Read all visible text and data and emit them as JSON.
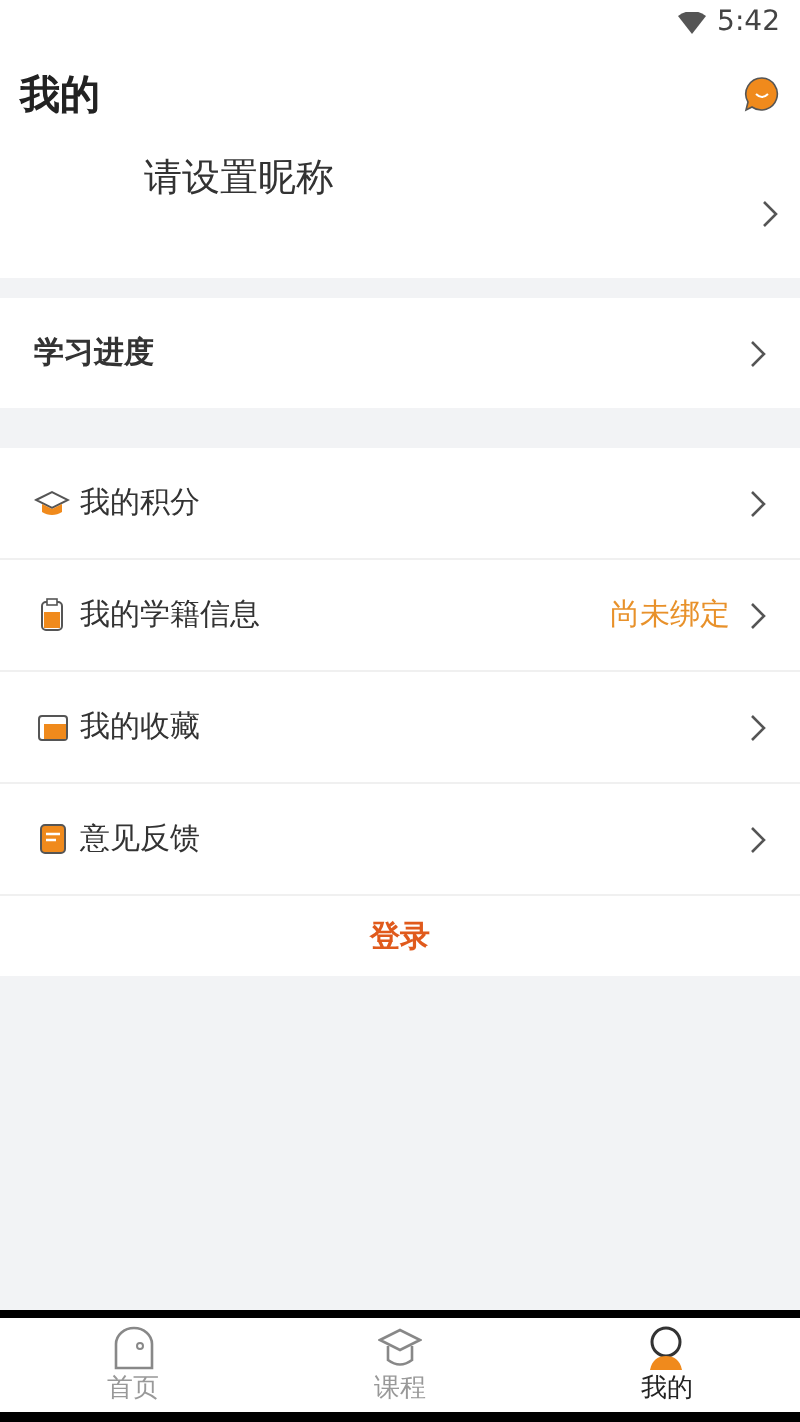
{
  "status_bar": {
    "time": "5:42"
  },
  "header": {
    "title": "我的"
  },
  "profile": {
    "nickname": "请设置昵称"
  },
  "progress": {
    "label": "学习进度"
  },
  "menu": [
    {
      "kind": "cap",
      "label": "我的积分"
    },
    {
      "kind": "clipboard",
      "label": "我的学籍信息",
      "value": "尚未绑定"
    },
    {
      "kind": "folder",
      "label": "我的收藏"
    },
    {
      "kind": "note",
      "label": "意见反馈"
    }
  ],
  "login": {
    "label": "登录"
  },
  "tabs": [
    {
      "kind": "home",
      "label": "首页",
      "selected": false
    },
    {
      "kind": "cap",
      "label": "课程",
      "selected": false
    },
    {
      "kind": "person",
      "label": "我的",
      "selected": true
    }
  ]
}
